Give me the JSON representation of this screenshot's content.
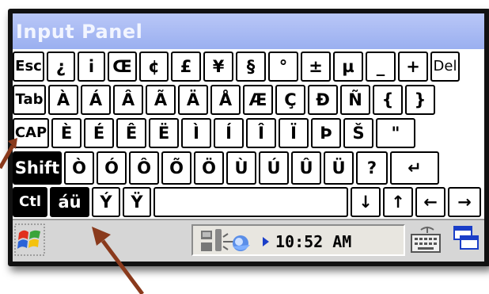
{
  "window": {
    "title": "Input Panel"
  },
  "keyboard": {
    "rows": [
      [
        "Esc",
        "¿",
        "i",
        "Œ",
        "¢",
        "£",
        "¥",
        "§",
        "°",
        "±",
        "µ",
        "_",
        "+",
        "Del"
      ],
      [
        "Tab",
        "À",
        "Á",
        "Â",
        "Ã",
        "Ä",
        "Å",
        "Æ",
        "Ç",
        "Ð",
        "Ñ",
        "{",
        "}"
      ],
      [
        "CAP",
        "È",
        "É",
        "Ê",
        "Ë",
        "Ì",
        "Í",
        "Î",
        "Ï",
        "Þ",
        "Š",
        "\""
      ],
      [
        "Shift",
        "Ò",
        "Ó",
        "Ô",
        "Õ",
        "Ö",
        "Ù",
        "Ú",
        "Û",
        "Ü",
        "?",
        "↵"
      ],
      [
        "Ctl",
        "áü",
        "Ý",
        "Ÿ",
        "",
        "↓",
        "↑",
        "←",
        "→"
      ]
    ]
  },
  "taskbar": {
    "time": "10:52 AM",
    "icons": [
      "start-windows-flag-icon",
      "network-connection-icon",
      "connection-arrow-icon",
      "keyboard-input-icon",
      "switch-windows-icon"
    ]
  },
  "colors": {
    "title_bar": "#a6b7f2",
    "annotation_arrow": "#8a3a1c"
  }
}
